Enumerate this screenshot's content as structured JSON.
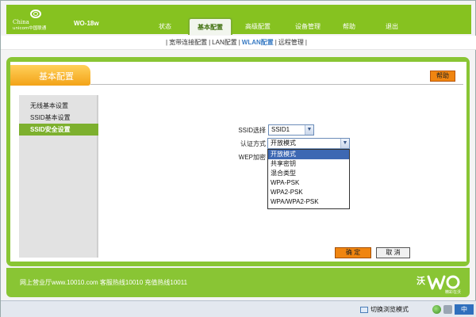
{
  "header": {
    "logo_line1": "China",
    "logo_line2": "unicom中国联通",
    "model": "WO-18w",
    "nav": [
      "状态",
      "基本配置",
      "高级配置",
      "设备管理",
      "帮助",
      "退出"
    ],
    "active_nav_index": 1
  },
  "subnav": {
    "items": [
      "宽带连接配置",
      "LAN配置",
      "WLAN配置",
      "远程管理"
    ],
    "active_index": 2
  },
  "page": {
    "title": "基本配置",
    "help_label": "帮助"
  },
  "side_menu": {
    "items": [
      "无线基本设置",
      "SSID基本设置",
      "SSID安全设置"
    ],
    "active_index": 2
  },
  "form": {
    "ssid_label": "SSID选择",
    "ssid_value": "SSID1",
    "auth_label": "认证方式",
    "auth_value": "开放模式",
    "wep_label": "WEP加密",
    "auth_options": [
      "开放模式",
      "共享密钥",
      "混合类型",
      "WPA-PSK",
      "WPA2-PSK",
      "WPA/WPA2-PSK"
    ],
    "highlighted_option_index": 0
  },
  "buttons": {
    "ok": "确 定",
    "cancel": "取 消"
  },
  "footer": {
    "text": "网上营业厅www.10010.com 客服热线10010 充值热线10011",
    "brand": "沃",
    "brand_small": "精彩在沃"
  },
  "statusbar": {
    "compat_label": "切换浏览模式",
    "ime_label": "中"
  },
  "colors": {
    "brand_green": "#86c220",
    "accent_orange": "#f08510",
    "highlight_blue": "#3d68b3"
  }
}
